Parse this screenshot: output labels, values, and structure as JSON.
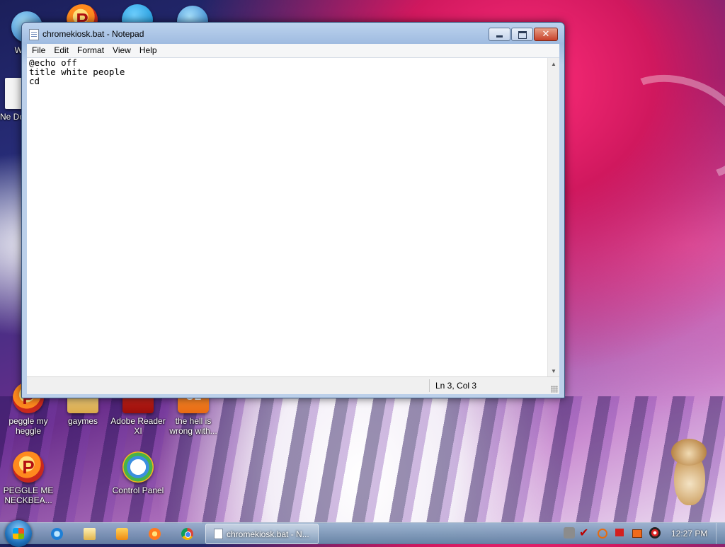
{
  "desktop": {
    "icons": [
      {
        "label": "WIN V",
        "icon": "windows-globe-icon"
      },
      {
        "label": "",
        "icon": "peggle-icon"
      },
      {
        "label": "",
        "icon": "skype-icon"
      },
      {
        "label": "",
        "icon": "globe-icon"
      },
      {
        "label": "Ne Docu",
        "icon": "new-document-icon"
      },
      {
        "label": "peggle my heggle",
        "icon": "peggle-icon"
      },
      {
        "label": "gaymes",
        "icon": "folder-icon"
      },
      {
        "label": "Adobe Reader XI",
        "icon": "adobe-reader-icon"
      },
      {
        "label": "the hell is wrong with...",
        "icon": "aol-icon"
      },
      {
        "label": "PEGGLE ME NECKBEA...",
        "icon": "peggle-icon"
      },
      {
        "label": "Control Panel",
        "icon": "control-panel-icon"
      }
    ]
  },
  "window": {
    "title": "chromekiosk.bat - Notepad",
    "controls": {
      "minimize": "minimize",
      "maximize": "maximize",
      "close": "✕"
    },
    "menu": [
      "File",
      "Edit",
      "Format",
      "View",
      "Help"
    ],
    "content": "@echo off\ntitle white people\ncd",
    "status": {
      "position": "Ln 3, Col 3"
    }
  },
  "taskbar": {
    "pinned": [
      "internet-explorer-icon",
      "windows-explorer-icon",
      "media-player-icon",
      "game-icon",
      "chrome-icon"
    ],
    "active_task": "chromekiosk.bat - N...",
    "tray_icons": [
      "network-icon",
      "checkmark-icon",
      "search-icon",
      "flag-icon",
      "action-center-icon",
      "volume-icon"
    ],
    "clock": "12:27 PM"
  }
}
